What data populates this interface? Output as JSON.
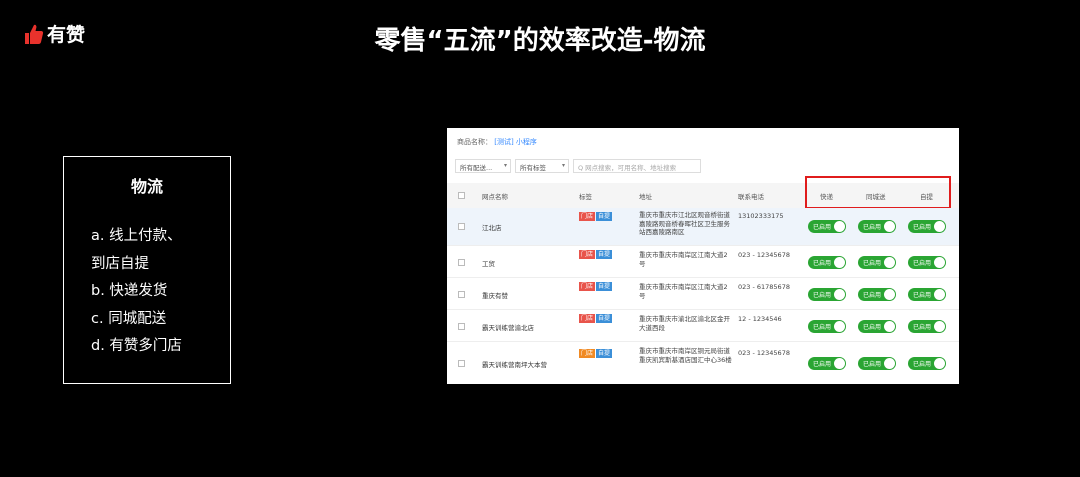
{
  "logo": {
    "text": "有赞",
    "icon": "thumbs-up-icon",
    "color": "#e8322c"
  },
  "slide_title": "零售“五流”的效率改造-物流",
  "left_panel": {
    "title": "物流",
    "items": [
      "a. 线上付款、",
      "到店自提",
      "b. 快递发货",
      "c. 同城配送",
      "d. 有赞多门店"
    ]
  },
  "screenshot": {
    "product_label": "商品名称：",
    "product_link": "[测试] 小程序",
    "filter_delivery": "所有配送...",
    "filter_tags": "所有标签",
    "search_placeholder": "Q 网点搜索，可用名称、地址搜索",
    "columns": {
      "name": "网点名称",
      "tags": "标签",
      "address": "地址",
      "phone": "联系电话",
      "express": "快递",
      "city": "同城送",
      "pickup": "自提"
    },
    "tag_store": "门店",
    "tag_self": "自提",
    "toggle_label": "已启用",
    "rows": [
      {
        "name": "江北店",
        "address": "重庆市重庆市江北区观音桥街道嘉陵路观音桥春晖社区卫生服务站西嘉陵路南区",
        "phone": "13102333175"
      },
      {
        "name": "工贸",
        "address": "重庆市重庆市南岸区江南大道2号",
        "phone": "023 - 12345678"
      },
      {
        "name": "重庆有赞",
        "address": "重庆市重庆市南岸区江南大道2号",
        "phone": "023 - 61785678"
      },
      {
        "name": "霸天训练营渝北店",
        "address": "重庆市重庆市渝北区渝北区金开大道西段",
        "phone": "12 - 1234546"
      },
      {
        "name": "霸天训练营南坪大本营",
        "address": "重庆市重庆市南岸区铜元局街道重庆凯宾斯基酒店国汇中心36楼",
        "phone": "023 - 12345678"
      }
    ]
  }
}
